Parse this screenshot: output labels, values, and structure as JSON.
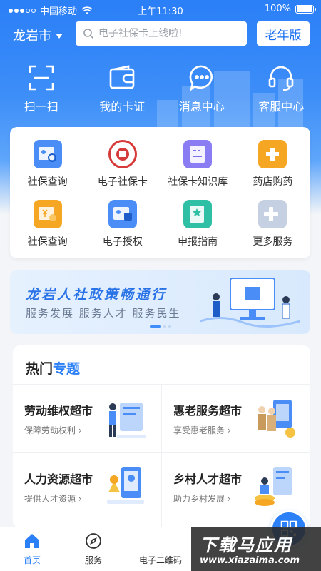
{
  "status": {
    "carrier": "中国移动",
    "time": "上午11:30",
    "battery": "100%",
    "battery_level": 1.0,
    "signal_bars": 3
  },
  "topbar": {
    "city": "龙岩市",
    "search_placeholder": "电子社保卡上线啦!",
    "elder_mode": "老年版"
  },
  "quick_actions": [
    {
      "label": "扫一扫",
      "icon": "scan-icon"
    },
    {
      "label": "我的卡证",
      "icon": "wallet-icon"
    },
    {
      "label": "消息中心",
      "icon": "message-icon"
    },
    {
      "label": "客服中心",
      "icon": "headset-icon"
    }
  ],
  "services": [
    {
      "label": "社保查询",
      "icon": "social-security-query-icon",
      "color": "#4a8df6"
    },
    {
      "label": "电子社保卡",
      "icon": "e-card-badge-icon",
      "color": "#d63a3a"
    },
    {
      "label": "社保卡知识库",
      "icon": "knowledge-base-icon",
      "color": "#7c6ef0"
    },
    {
      "label": "药店购药",
      "icon": "pharmacy-icon",
      "color": "#f5a623"
    },
    {
      "label": "社保查询",
      "icon": "yuan-query-icon",
      "color": "#f5a623"
    },
    {
      "label": "电子授权",
      "icon": "authorization-icon",
      "color": "#4a8df6"
    },
    {
      "label": "申报指南",
      "icon": "guide-icon",
      "color": "#2fbfa4"
    },
    {
      "label": "更多服务",
      "icon": "more-services-icon",
      "color": "#a9b8d4"
    }
  ],
  "banner": {
    "title": "龙岩人社政策畅通行",
    "subtitle": "服务发展 服务人才 服务民生"
  },
  "topics": {
    "title_plain": "热门",
    "title_accent": "专题",
    "items": [
      {
        "title": "劳动维权超市",
        "subtitle": "保障劳动权利",
        "icon": "labor-rights-illustration"
      },
      {
        "title": "惠老服务超市",
        "subtitle": "享受惠老服务",
        "icon": "elderly-service-illustration"
      },
      {
        "title": "人力资源超市",
        "subtitle": "提供人才资源",
        "icon": "human-resources-illustration"
      },
      {
        "title": "乡村人才超市",
        "subtitle": "助力乡村发展",
        "icon": "rural-talent-illustration"
      }
    ]
  },
  "tabs": [
    {
      "label": "首页",
      "icon": "home-icon"
    },
    {
      "label": "服务",
      "icon": "compass-icon"
    },
    {
      "label": "电子二维码",
      "icon": "qr-code-icon"
    }
  ],
  "watermark": {
    "main": "下载马应用",
    "url": "www.xiazaima.com"
  }
}
